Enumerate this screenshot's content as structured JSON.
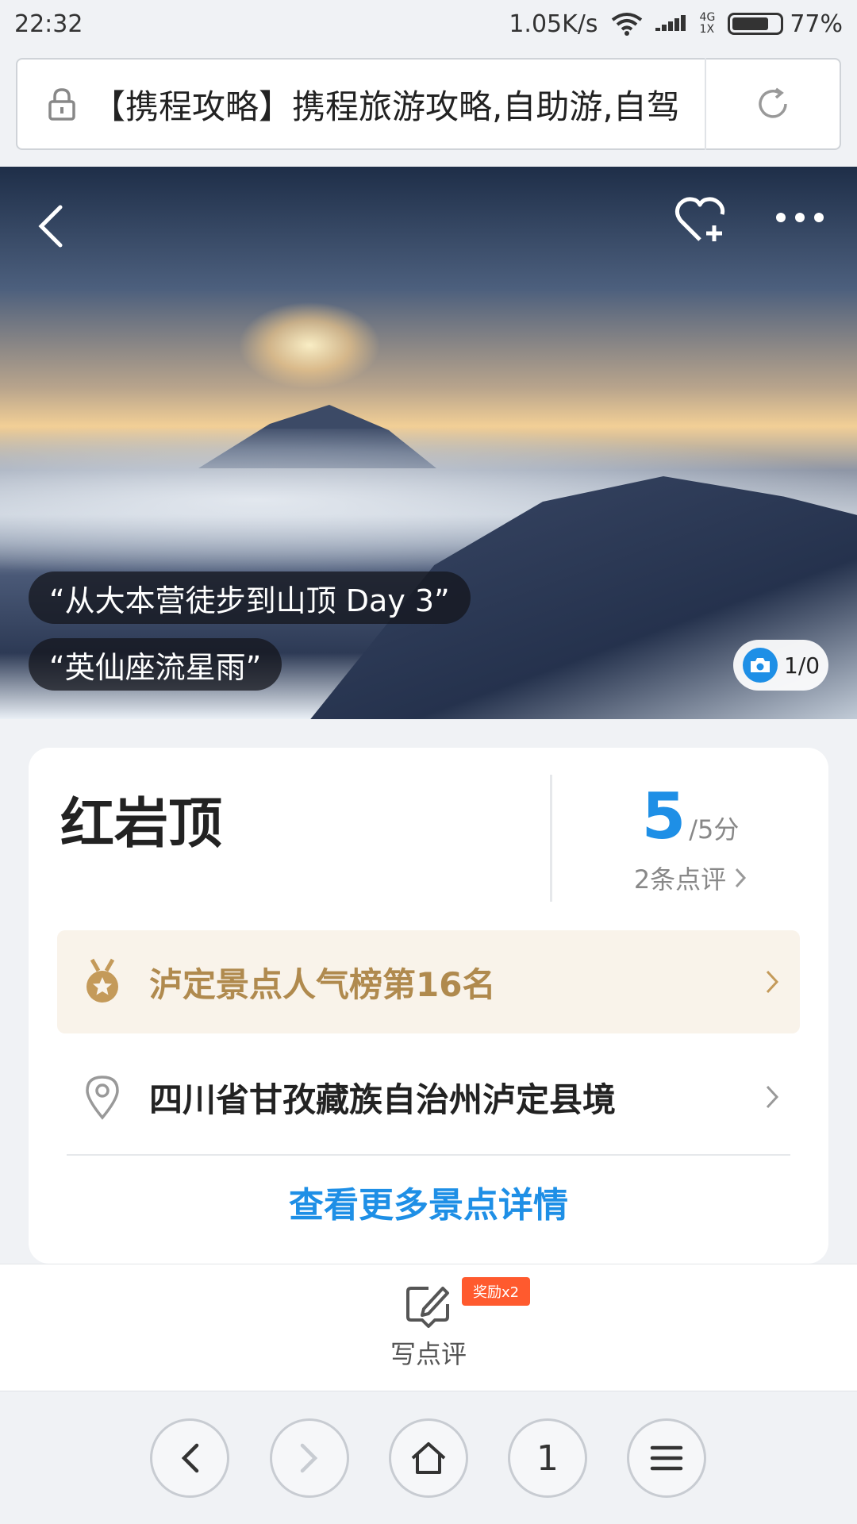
{
  "status_bar": {
    "time": "22:32",
    "network_speed": "1.05K/s",
    "network_type_top": "4G",
    "network_type_bottom": "1X",
    "battery_percent": "77%",
    "battery_level": 0.77
  },
  "url_bar": {
    "text": "【携程攻略】携程旅游攻略,自助游,自驾"
  },
  "hero": {
    "tags": [
      "“从大本营徒步到山顶 Day 3”",
      "“英仙座流星雨”"
    ],
    "photo_counter": "1/0"
  },
  "attraction": {
    "name": "红岩顶",
    "score": "5",
    "score_max": "/5分",
    "review_count": "2条点评",
    "ranking": "泸定景点人气榜第16名",
    "address": "四川省甘孜藏族自治州泸定县境",
    "more_details": "查看更多景点详情"
  },
  "review_bar": {
    "write_review": "写点评",
    "reward_badge": "奖励x2"
  },
  "browser_nav": {
    "tab_count": "1"
  },
  "colors": {
    "accent_blue": "#1e8fe6",
    "rank_gold": "#b08a4e",
    "rank_bg": "#f9f3ea",
    "reward_orange": "#ff5a2e"
  },
  "icons": [
    "lock-icon",
    "reload-icon",
    "back-arrow-icon",
    "favorite-heart-icon",
    "more-dots-icon",
    "camera-icon",
    "medal-icon",
    "location-pin-icon",
    "chevron-right-icon",
    "write-review-icon",
    "home-icon",
    "menu-icon"
  ]
}
